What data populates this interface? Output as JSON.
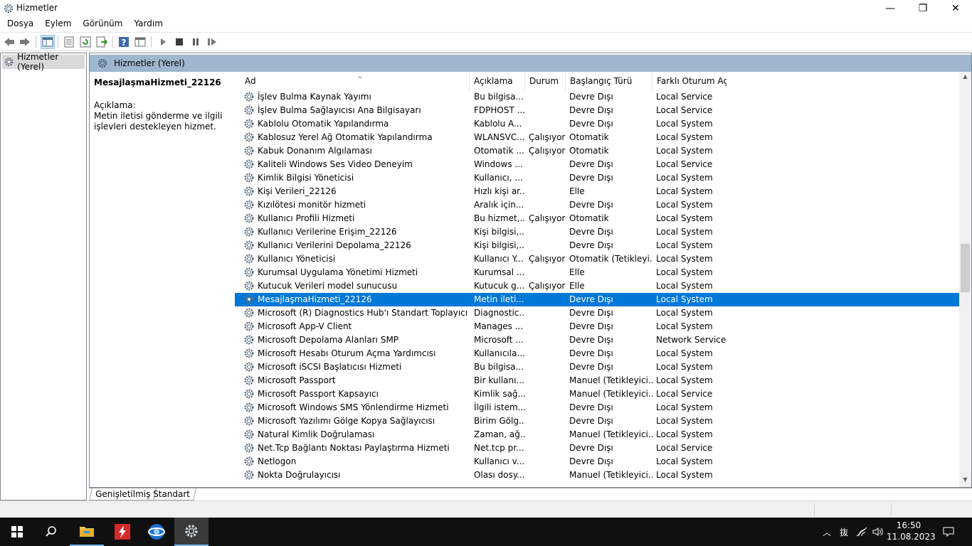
{
  "window": {
    "title": "Hizmetler",
    "minimize_glyph": "—",
    "maximize_glyph": "❐",
    "close_glyph": "✕"
  },
  "menu": [
    "Dosya",
    "Eylem",
    "Görünüm",
    "Yardım"
  ],
  "toolbar_icons": [
    "back-icon",
    "forward-icon",
    "show-hide-console-tree-icon",
    "properties-icon",
    "refresh-icon",
    "export-list-icon",
    "help-icon",
    "view-icon",
    "start-icon",
    "stop-icon",
    "pause-icon",
    "resume-icon"
  ],
  "tree": {
    "root_label": "Hizmetler (Yerel)"
  },
  "main": {
    "header_label": "Hizmetler (Yerel)",
    "selected_name": "MesajlaşmaHizmeti_22126",
    "description_label": "Açıklama:",
    "description_text": "Metin iletisi gönderme ve ilgili işlevleri destekleyen hizmet."
  },
  "columns": {
    "name": "Ad",
    "description": "Açıklama",
    "status": "Durum",
    "startup": "Başlangıç Türü",
    "logon": "Farklı Oturum Aç"
  },
  "services": [
    {
      "name": "İşlev Bulma Kaynak Yayımı",
      "desc": "Bu bilgisa...",
      "status": "",
      "startup": "Devre Dışı",
      "logon": "Local Service"
    },
    {
      "name": "İşlev Bulma Sağlayıcısı Ana Bilgisayarı",
      "desc": "FDPHOST ...",
      "status": "",
      "startup": "Devre Dışı",
      "logon": "Local Service"
    },
    {
      "name": "Kablolu Otomatik Yapılandırma",
      "desc": "Kablolu A...",
      "status": "",
      "startup": "Devre Dışı",
      "logon": "Local System"
    },
    {
      "name": "Kablosuz Yerel Ağ Otomatik Yapılandırma",
      "desc": "WLANSVC...",
      "status": "Çalışıyor",
      "startup": "Otomatik",
      "logon": "Local System"
    },
    {
      "name": "Kabuk Donanım Algılaması",
      "desc": "Otomatik ...",
      "status": "Çalışıyor",
      "startup": "Otomatik",
      "logon": "Local System"
    },
    {
      "name": "Kaliteli Windows Ses Video Deneyim",
      "desc": "Windows ...",
      "status": "",
      "startup": "Devre Dışı",
      "logon": "Local Service"
    },
    {
      "name": "Kimlik Bilgisi Yöneticisi",
      "desc": "Kullanıcı, ...",
      "status": "",
      "startup": "Devre Dışı",
      "logon": "Local System"
    },
    {
      "name": "Kişi Verileri_22126",
      "desc": "Hızlı kişi ar...",
      "status": "",
      "startup": "Elle",
      "logon": "Local System"
    },
    {
      "name": "Kızılötesi monitör hizmeti",
      "desc": "Aralık için...",
      "status": "",
      "startup": "Devre Dışı",
      "logon": "Local System"
    },
    {
      "name": "Kullanıcı Profili Hizmeti",
      "desc": "Bu hizmet,...",
      "status": "Çalışıyor",
      "startup": "Otomatik",
      "logon": "Local System"
    },
    {
      "name": "Kullanıcı Verilerine Erişim_22126",
      "desc": "Kişi bilgisi,...",
      "status": "",
      "startup": "Devre Dışı",
      "logon": "Local System"
    },
    {
      "name": "Kullanıcı Verilerini Depolama_22126",
      "desc": "Kişi bilgisi,...",
      "status": "",
      "startup": "Devre Dışı",
      "logon": "Local System"
    },
    {
      "name": "Kullanıcı Yöneticisi",
      "desc": "Kullanıcı Y...",
      "status": "Çalışıyor",
      "startup": "Otomatik (Tetikleyi...",
      "logon": "Local System"
    },
    {
      "name": "Kurumsal Uygulama Yönetimi Hizmeti",
      "desc": "Kurumsal ...",
      "status": "",
      "startup": "Elle",
      "logon": "Local System"
    },
    {
      "name": "Kutucuk Verileri model sunucusu",
      "desc": "Kutucuk g...",
      "status": "Çalışıyor",
      "startup": "Elle",
      "logon": "Local System"
    },
    {
      "name": "MesajlaşmaHizmeti_22126",
      "desc": "Metin ileti...",
      "status": "",
      "startup": "Devre Dışı",
      "logon": "Local System",
      "selected": true
    },
    {
      "name": "Microsoft (R) Diagnostics Hub'ı Standart Toplayıcı Hiz...",
      "desc": "Diagnostic...",
      "status": "",
      "startup": "Devre Dışı",
      "logon": "Local System"
    },
    {
      "name": "Microsoft App-V Client",
      "desc": "Manages ...",
      "status": "",
      "startup": "Devre Dışı",
      "logon": "Local System"
    },
    {
      "name": "Microsoft Depolama Alanları SMP",
      "desc": "Microsoft ...",
      "status": "",
      "startup": "Devre Dışı",
      "logon": "Network Service"
    },
    {
      "name": "Microsoft Hesabı Oturum Açma Yardımcısı",
      "desc": "Kullanıcıla...",
      "status": "",
      "startup": "Devre Dışı",
      "logon": "Local System"
    },
    {
      "name": "Microsoft iSCSI Başlatıcısı Hizmeti",
      "desc": "Bu bilgisa...",
      "status": "",
      "startup": "Devre Dışı",
      "logon": "Local System"
    },
    {
      "name": "Microsoft Passport",
      "desc": "Bir kullanı...",
      "status": "",
      "startup": "Manuel (Tetikleyici...",
      "logon": "Local System"
    },
    {
      "name": "Microsoft Passport Kapsayıcı",
      "desc": "Kimlik sağ...",
      "status": "",
      "startup": "Manuel (Tetikleyici...",
      "logon": "Local Service"
    },
    {
      "name": "Microsoft Windows SMS Yönlendirme Hizmeti",
      "desc": "İlgili istem...",
      "status": "",
      "startup": "Devre Dışı",
      "logon": "Local System"
    },
    {
      "name": "Microsoft Yazılımı Gölge Kopya Sağlayıcısı",
      "desc": "Birim Gölg...",
      "status": "",
      "startup": "Devre Dışı",
      "logon": "Local System"
    },
    {
      "name": "Natural Kimlik Doğrulaması",
      "desc": "Zaman, ağ...",
      "status": "",
      "startup": "Manuel (Tetikleyici...",
      "logon": "Local System"
    },
    {
      "name": "Net.Tcp Bağlantı Noktası Paylaştırma Hizmeti",
      "desc": "Net.tcp pr...",
      "status": "",
      "startup": "Devre Dışı",
      "logon": "Local Service"
    },
    {
      "name": "Netlogon",
      "desc": "Kullanıcı v...",
      "status": "",
      "startup": "Devre Dışı",
      "logon": "Local System"
    },
    {
      "name": "Nokta Doğrulayıcısı",
      "desc": "Olası dosy...",
      "status": "",
      "startup": "Manuel (Tetikleyici...",
      "logon": "Local System"
    }
  ],
  "bottom_tabs": {
    "extended": "Genişletilmiş",
    "standard": "Standart"
  },
  "taskbar": {
    "apps": [
      "windows-start-icon",
      "search-icon",
      "file-explorer-icon",
      "flash-app-icon",
      "browser-icon",
      "services-gear-icon"
    ],
    "tray_ime": "抜",
    "time": "16:50",
    "date": "11.08.2023"
  },
  "colors": {
    "selection": "#0078d7",
    "header_band": "#9eb6ce",
    "taskbar": "#101010"
  }
}
